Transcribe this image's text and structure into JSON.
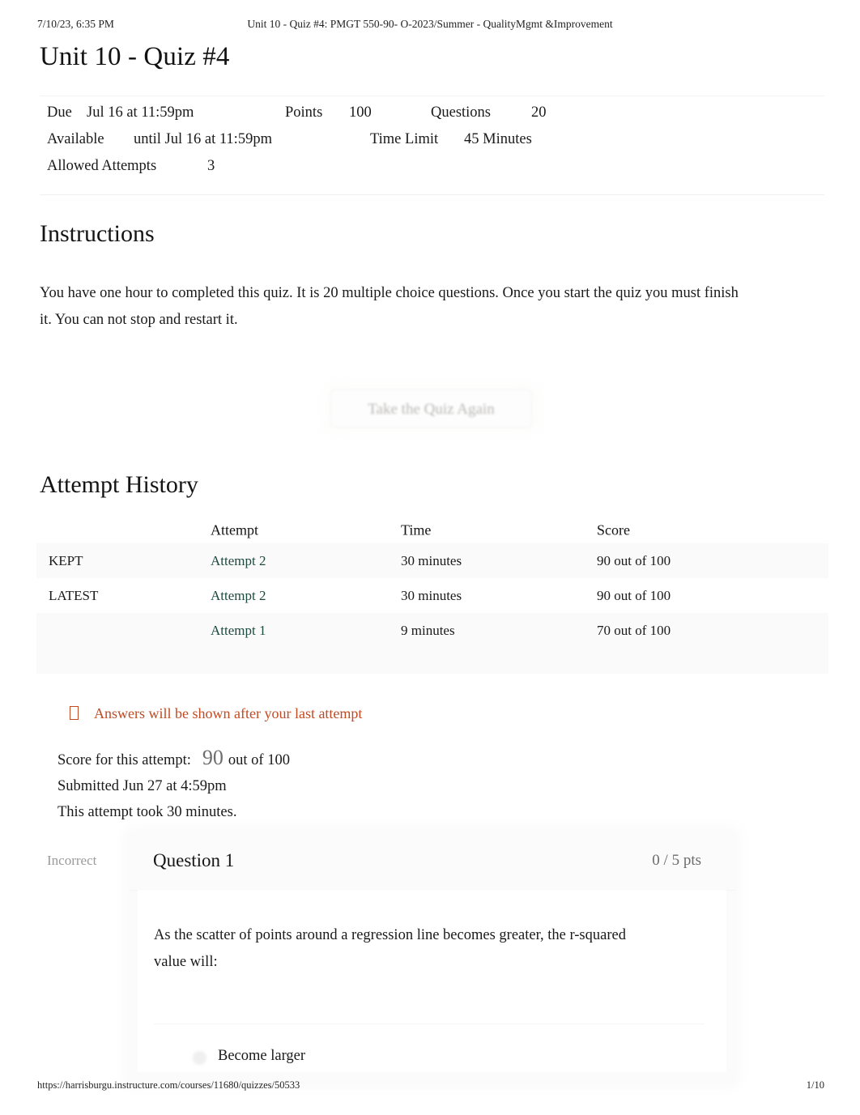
{
  "print_header": {
    "date": "7/10/23, 6:35 PM",
    "document_title": "Unit 10 - Quiz #4: PMGT 550-90- O-2023/Summer - QualityMgmt &Improvement"
  },
  "page_title": "Unit 10 - Quiz #4",
  "quiz_meta": {
    "due_label": "Due",
    "due_value": "Jul 16 at 11:59pm",
    "points_label": "Points",
    "points_value": "100",
    "questions_label": "Questions",
    "questions_value": "20",
    "available_label": "Available",
    "available_value": "until Jul 16 at 11:59pm",
    "time_limit_label": "Time Limit",
    "time_limit_value": "45 Minutes",
    "allowed_attempts_label": "Allowed Attempts",
    "allowed_attempts_value": "3"
  },
  "instructions": {
    "heading": "Instructions",
    "body": "You have one hour to completed this quiz. It is 20 multiple choice questions. Once you start the quiz you must finish it. You can not stop and restart it."
  },
  "take_again_button": {
    "label": "Take the Quiz Again"
  },
  "attempt_history": {
    "heading": "Attempt History",
    "columns": {
      "flag": "",
      "attempt": "Attempt",
      "time": "Time",
      "score": "Score"
    },
    "rows": [
      {
        "flag": "KEPT",
        "attempt": "Attempt 2",
        "time": "30 minutes",
        "score": "90 out of 100"
      },
      {
        "flag": "LATEST",
        "attempt": "Attempt 2",
        "time": "30 minutes",
        "score": "90 out of 100"
      },
      {
        "flag": "",
        "attempt": "Attempt 1",
        "time": "9 minutes",
        "score": "70 out of 100"
      }
    ]
  },
  "answers_warning": {
    "icon": "missing-glyph-box-icon",
    "text": "Answers will be shown after your last attempt",
    "color": "#c04a22"
  },
  "attempt_summary": {
    "score_label": "Score for this attempt:",
    "score_value": "90",
    "score_out_of": "out of 100",
    "submitted": "Submitted Jun 27 at 4:59pm",
    "duration": "This attempt took 30 minutes."
  },
  "question": {
    "status": "Incorrect",
    "number": "Question 1",
    "points": "0 / 5 pts",
    "text": "As the scatter of points around a regression line becomes greater, the r-squared value will:",
    "answers": [
      {
        "label": "Become larger",
        "selected": false
      }
    ]
  },
  "print_footer": {
    "url": "https://harrisburgu.instructure.com/courses/11680/quizzes/50533",
    "page": "1/10"
  },
  "colors": {
    "link_teal": "#1d4a3f",
    "warning_orange": "#c04a22",
    "muted_gray": "#9a9a9a"
  }
}
